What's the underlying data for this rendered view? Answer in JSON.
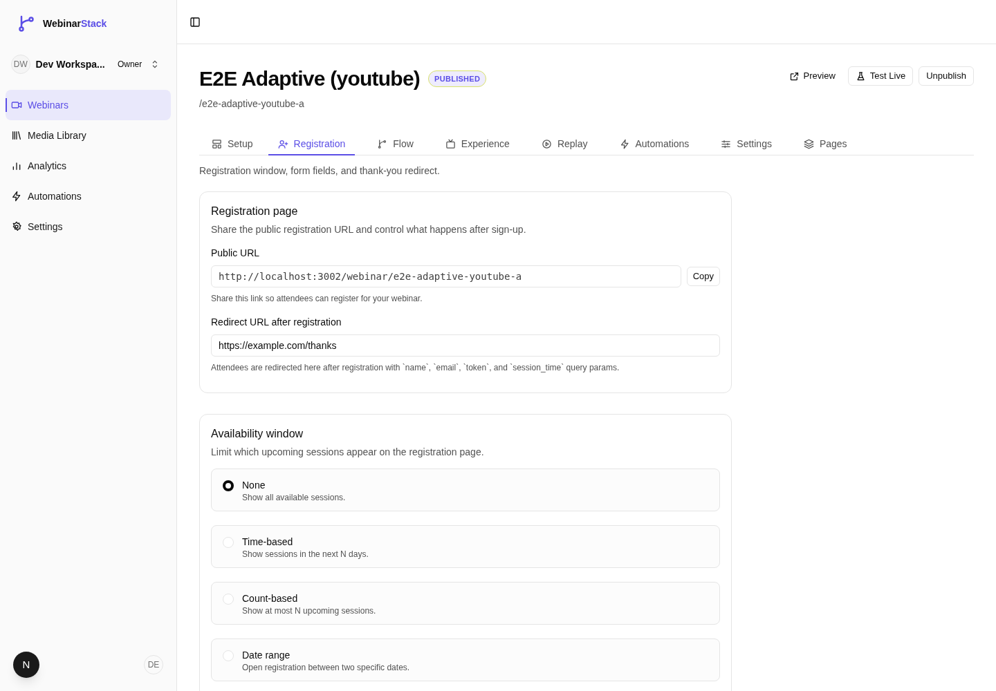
{
  "brand": {
    "name": "Webinar",
    "accent": "Stack"
  },
  "workspace": {
    "initials": "DW",
    "name": "Dev Workspa...",
    "role": "Owner"
  },
  "sidebar": {
    "items": [
      {
        "label": "Webinars",
        "selected": true
      },
      {
        "label": "Media Library",
        "selected": false
      },
      {
        "label": "Analytics",
        "selected": false
      },
      {
        "label": "Automations",
        "selected": false
      },
      {
        "label": "Settings",
        "selected": false
      }
    ]
  },
  "footer": {
    "dev_badge": "N",
    "user_initials": "DE"
  },
  "page": {
    "title": "E2E Adaptive (youtube)",
    "status": "PUBLISHED",
    "slug": "/e2e-adaptive-youtube-a",
    "actions": [
      {
        "label": "Preview",
        "kind": "ghost"
      },
      {
        "label": "Test Live",
        "kind": "outline"
      },
      {
        "label": "Unpublish",
        "kind": "outline"
      }
    ]
  },
  "tabs": [
    {
      "label": "Setup",
      "selected": false
    },
    {
      "label": "Registration",
      "selected": true
    },
    {
      "label": "Flow",
      "selected": false
    },
    {
      "label": "Experience",
      "selected": false
    },
    {
      "label": "Replay",
      "selected": false
    },
    {
      "label": "Automations",
      "selected": false
    },
    {
      "label": "Settings",
      "selected": false
    },
    {
      "label": "Pages",
      "selected": false
    }
  ],
  "tab_description": "Registration window, form fields, and thank-you redirect.",
  "registration_card": {
    "title": "Registration page",
    "description": "Share the public registration URL and control what happens after sign-up.",
    "public_url": {
      "label": "Public URL",
      "value": "http://localhost:3002/webinar/e2e-adaptive-youtube-a",
      "button": "Copy",
      "help": "Share this link so attendees can register for your webinar."
    },
    "redirect_url": {
      "label": "Redirect URL after registration",
      "value": "https://example.com/thanks",
      "help": "Attendees are redirected here after registration with `name`, `email`, `token`, and `session_time` query params."
    }
  },
  "availability_card": {
    "title": "Availability window",
    "description": "Limit which upcoming sessions appear on the registration page.",
    "options": [
      {
        "label": "None",
        "description": "Show all available sessions.",
        "selected": true
      },
      {
        "label": "Time-based",
        "description": "Show sessions in the next N days.",
        "selected": false
      },
      {
        "label": "Count-based",
        "description": "Show at most N upcoming sessions.",
        "selected": false
      },
      {
        "label": "Date range",
        "description": "Open registration between two specific dates.",
        "selected": false
      }
    ]
  }
}
